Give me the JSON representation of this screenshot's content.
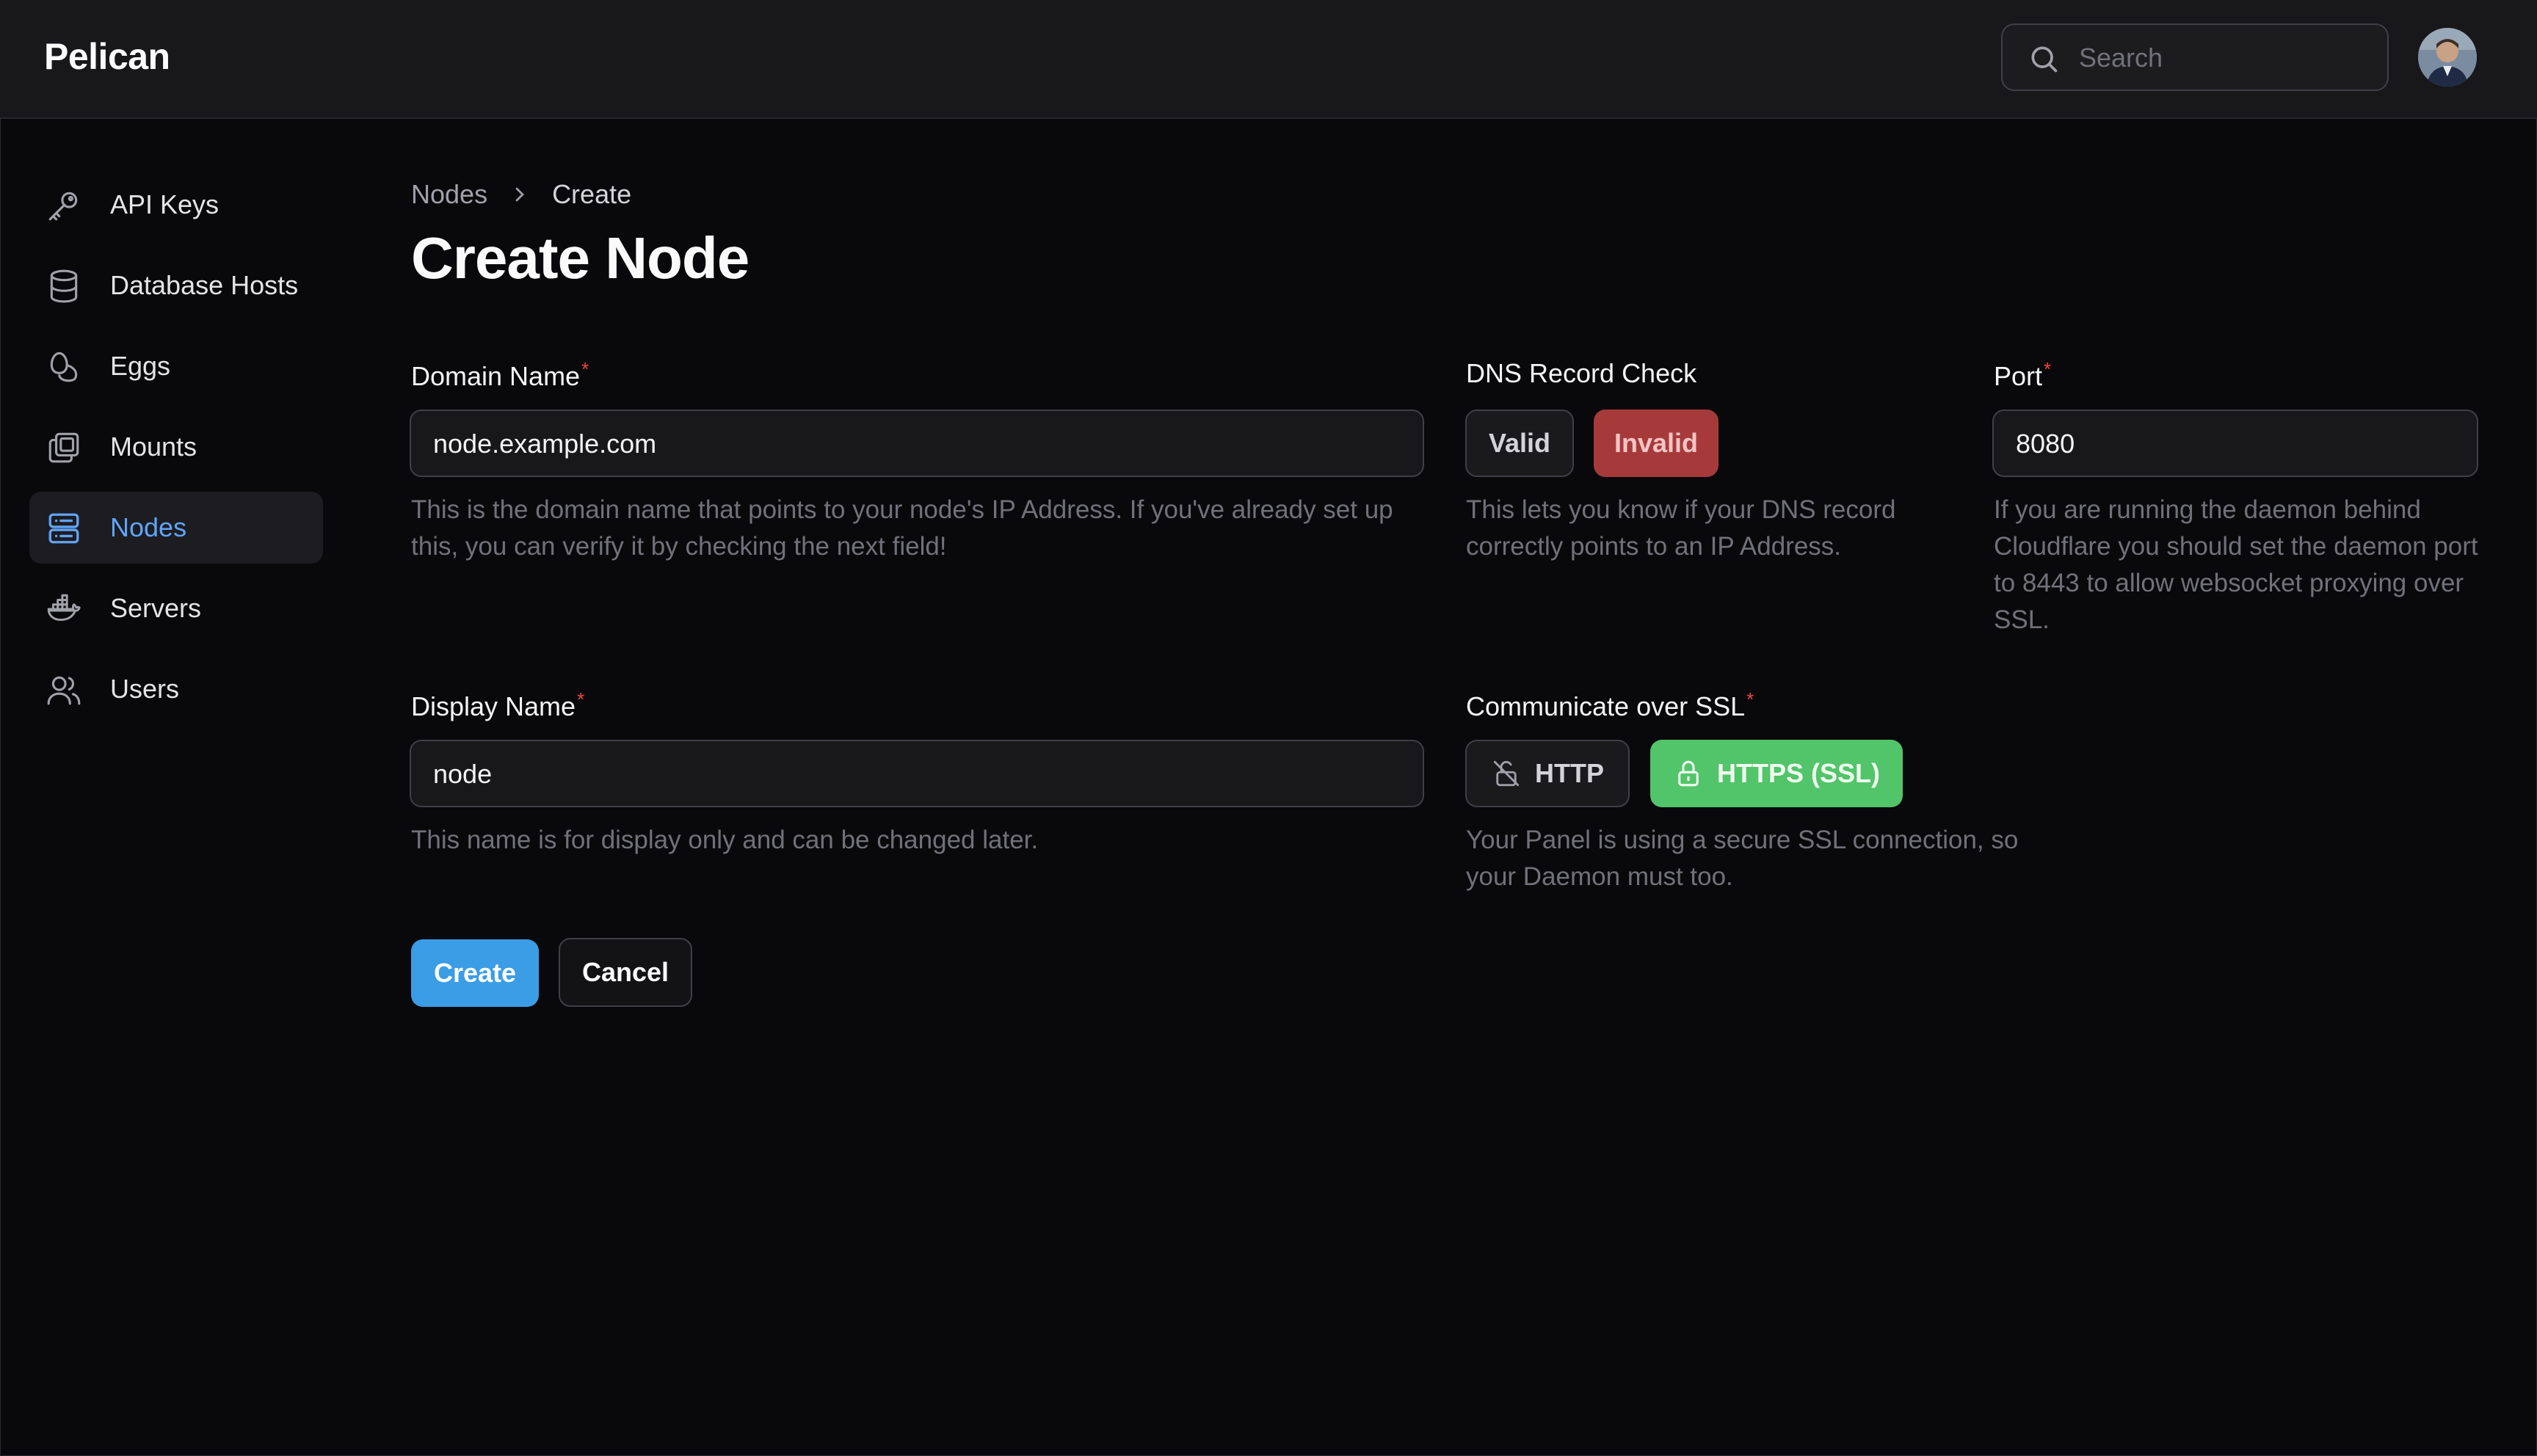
{
  "app": {
    "brand": "Pelican"
  },
  "header": {
    "search_placeholder": "Search"
  },
  "sidebar": {
    "items": [
      {
        "label": "API Keys",
        "icon": "key-icon"
      },
      {
        "label": "Database Hosts",
        "icon": "database-icon"
      },
      {
        "label": "Eggs",
        "icon": "eggs-icon"
      },
      {
        "label": "Mounts",
        "icon": "mounts-icon"
      },
      {
        "label": "Nodes",
        "icon": "server-icon",
        "active": true
      },
      {
        "label": "Servers",
        "icon": "docker-icon"
      },
      {
        "label": "Users",
        "icon": "users-icon"
      }
    ]
  },
  "breadcrumb": {
    "parent": "Nodes",
    "current": "Create"
  },
  "page": {
    "title": "Create Node"
  },
  "form": {
    "domain": {
      "label": "Domain Name",
      "value": "node.example.com",
      "help": "This is the domain name that points to your node's IP Address. If you've already set up this, you can verify it by checking the next field!"
    },
    "dns": {
      "label": "DNS Record Check",
      "valid_label": "Valid",
      "invalid_label": "Invalid",
      "selected": "Invalid",
      "help": "This lets you know if your DNS record correctly points to an IP Address."
    },
    "port": {
      "label": "Port",
      "value": "8080",
      "help": "If you are running the daemon behind Cloudflare you should set the daemon port to 8443 to allow websocket proxying over SSL."
    },
    "display_name": {
      "label": "Display Name",
      "value": "node",
      "help": "This name is for display only and can be changed later."
    },
    "ssl": {
      "label": "Communicate over SSL",
      "http_label": "HTTP",
      "https_label": "HTTPS (SSL)",
      "selected": "HTTPS (SSL)",
      "help": "Your Panel is using a secure SSL connection, so your Daemon must too."
    },
    "required_marker": "*"
  },
  "actions": {
    "create_label": "Create",
    "cancel_label": "Cancel"
  },
  "colors": {
    "accent": "#3b9de6",
    "active_nav": "#60a5fa",
    "danger": "#a63a3a",
    "success": "#52c46a",
    "required": "#ef4444"
  }
}
